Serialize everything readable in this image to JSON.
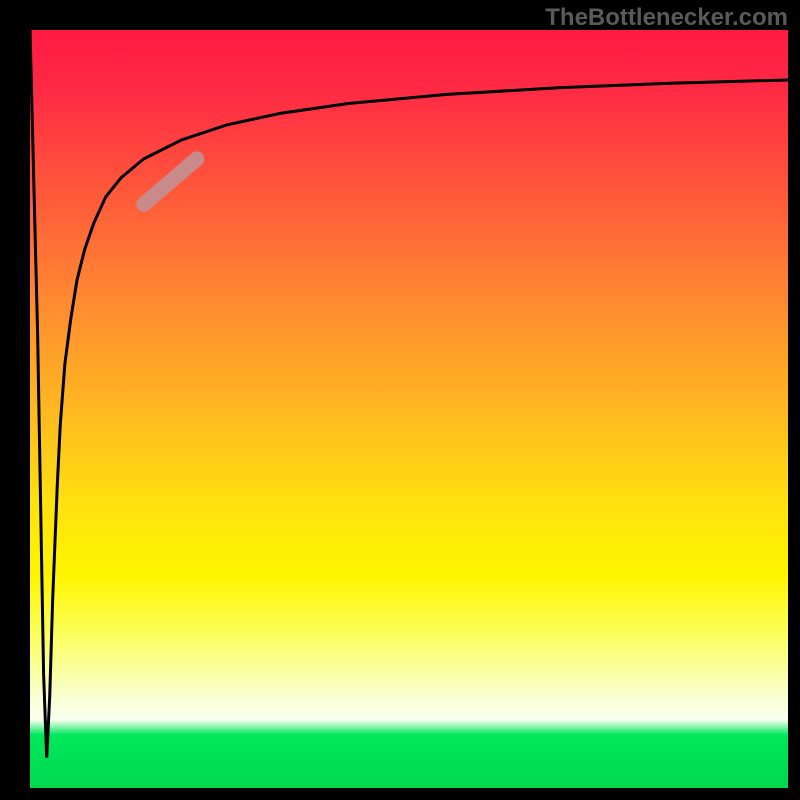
{
  "attribution": "TheBottlenecker.com",
  "chart_data": {
    "type": "line",
    "title": "",
    "xlabel": "",
    "ylabel": "",
    "xlim": [
      0,
      100
    ],
    "ylim": [
      0,
      100
    ],
    "gradient_stops": [
      {
        "pct": 0,
        "color": "#ff1a44"
      },
      {
        "pct": 50,
        "color": "#ffe010"
      },
      {
        "pct": 92,
        "color": "#fcffe0"
      },
      {
        "pct": 93,
        "color": "#00e85a"
      },
      {
        "pct": 100,
        "color": "#00d850"
      }
    ],
    "series": [
      {
        "name": "curve",
        "x": [
          0,
          1,
          1.8,
          2.2,
          2.6,
          3,
          3.6,
          4,
          4.6,
          5.4,
          6.2,
          7.2,
          8.4,
          10,
          12,
          15,
          20,
          26,
          33,
          42,
          55,
          70,
          85,
          100
        ],
        "y": [
          100,
          60,
          15,
          4,
          12,
          25,
          40,
          48,
          56,
          62,
          67,
          71,
          74.5,
          78,
          80.5,
          83,
          85.5,
          87.5,
          89,
          90.3,
          91.5,
          92.4,
          93,
          93.4
        ]
      }
    ],
    "highlight_segment": {
      "x_start": 15,
      "x_end": 22,
      "y_start": 77,
      "y_end": 83
    }
  }
}
